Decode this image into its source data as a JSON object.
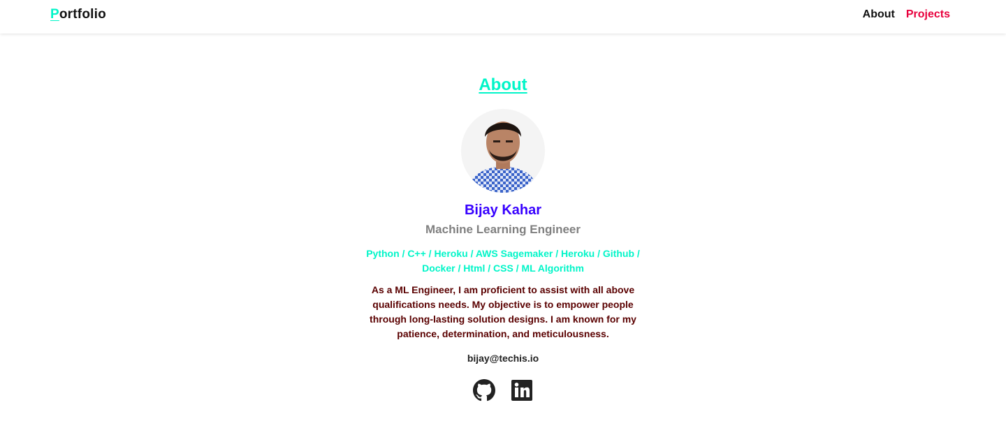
{
  "nav": {
    "brand_first": "P",
    "brand_rest": "ortfolio",
    "links": [
      {
        "label": "About",
        "color": "#111111"
      },
      {
        "label": "Projects",
        "color": "#e8003d"
      }
    ]
  },
  "about": {
    "title": "About",
    "name": "Bijay Kahar",
    "role": "Machine Learning Engineer",
    "skills_line1": "Python / C++ / Heroku / AWS Sagemaker / Heroku / Github /",
    "skills_line2": "Docker / Html / CSS / ML Algorithm",
    "bio": "As a ML Engineer, I am proficient to assist with all above qualifications needs. My objective is to empower people through long-lasting solution designs. I am known for my patience, determination, and meticulousness.",
    "email": "bijay@techis.io"
  },
  "social": [
    {
      "icon": "github-icon"
    },
    {
      "icon": "linkedin-icon"
    }
  ],
  "colors": {
    "accent": "#00f5c8",
    "name": "#3700ff",
    "projects_link": "#e8003d",
    "bio_text": "#5a0000"
  }
}
